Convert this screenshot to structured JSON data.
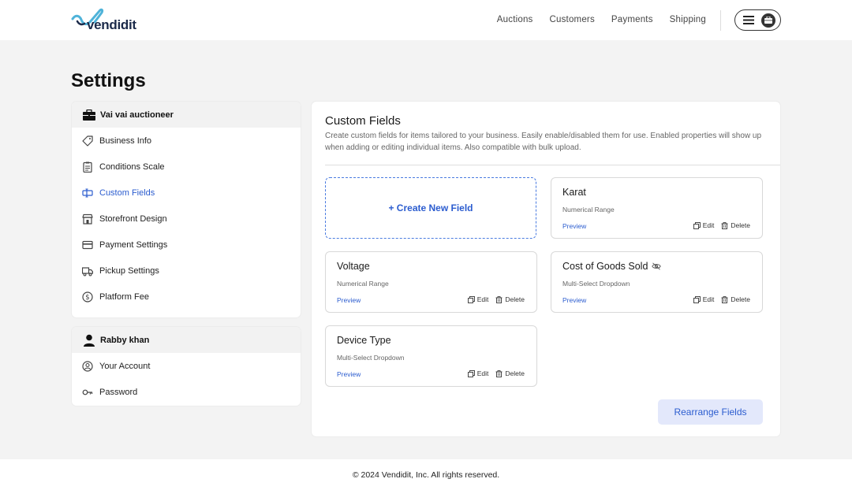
{
  "brand": {
    "name": "vendidit",
    "accent": "#2b5ccf",
    "logo_color": "#4fb3d9"
  },
  "nav": {
    "items": [
      "Auctions",
      "Customers",
      "Payments",
      "Shipping"
    ]
  },
  "page": {
    "title": "Settings"
  },
  "sidebar": {
    "business": {
      "name": "Vai vai auctioneer",
      "items": [
        {
          "label": "Business Info",
          "icon": "tag-icon"
        },
        {
          "label": "Conditions Scale",
          "icon": "clipboard-icon"
        },
        {
          "label": "Custom Fields",
          "icon": "fields-icon",
          "active": true
        },
        {
          "label": "Storefront Design",
          "icon": "store-icon"
        },
        {
          "label": "Payment Settings",
          "icon": "card-icon"
        },
        {
          "label": "Pickup Settings",
          "icon": "truck-icon"
        },
        {
          "label": "Platform Fee",
          "icon": "dollar-icon"
        }
      ]
    },
    "user": {
      "name": "Rabby khan",
      "items": [
        {
          "label": "Your Account",
          "icon": "user-circle-icon"
        },
        {
          "label": "Password",
          "icon": "key-icon"
        }
      ]
    }
  },
  "main": {
    "title": "Custom Fields",
    "description": "Create custom fields for items tailored to your business. Easily enable/disabled them for use. Enabled properties will show up when adding or editing individual items. Also compatible with bulk upload.",
    "create_label": "+ Create New Field",
    "preview_label": "Preview",
    "edit_label": "Edit",
    "delete_label": "Delete",
    "rearrange_label": "Rearrange Fields",
    "fields": [
      {
        "name": "Karat",
        "type": "Numerical Range",
        "hidden": false
      },
      {
        "name": "Voltage",
        "type": "Numerical Range",
        "hidden": false
      },
      {
        "name": "Cost of Goods Sold",
        "type": "Multi-Select Dropdown",
        "hidden": true
      },
      {
        "name": "Device Type",
        "type": "Multi-Select Dropdown",
        "hidden": false
      }
    ]
  },
  "footer": {
    "text": "© 2024 Vendidit, Inc. All rights reserved."
  }
}
